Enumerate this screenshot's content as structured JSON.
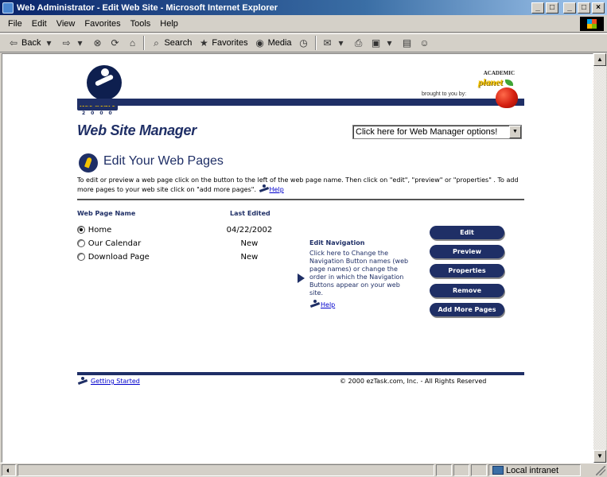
{
  "window": {
    "title": "Web Administrator - Edit Web Site - Microsoft Internet Explorer"
  },
  "menu": [
    "File",
    "Edit",
    "View",
    "Favorites",
    "Tools",
    "Help"
  ],
  "toolbar": {
    "back": "Back",
    "search": "Search",
    "favorites": "Favorites",
    "media": "Media"
  },
  "header": {
    "brought_by": "brought to you by:",
    "partner_top": "ACADEMIC",
    "partner_name": "planet",
    "logo_word": "net Start",
    "logo_year": "2000"
  },
  "site_manager": {
    "title": "Web Site Manager",
    "options_select": "Click here for Web Manager options!"
  },
  "main": {
    "heading": "Edit Your Web Pages",
    "intro": "To edit or preview a web page click on the button to the left of the web page name.  Then click on \"edit\", \"preview\" or \"properties\" .  To add more pages to your web site click on \"add more pages\".",
    "help_label": "Help",
    "col_name": "Web Page Name",
    "col_edited": "Last Edited",
    "pages": [
      {
        "name": "Home",
        "edited": "04/22/2002",
        "selected": true
      },
      {
        "name": "Our Calendar",
        "edited": "New",
        "selected": false
      },
      {
        "name": "Download Page",
        "edited": "New",
        "selected": false
      }
    ],
    "nav_title": "Edit Navigation",
    "nav_text": "Click here to Change the Navigation Button names (web page names) or change the order in which the Navigation Buttons appear on your web site.",
    "nav_help": "Help",
    "buttons": {
      "edit": "Edit",
      "preview": "Preview",
      "properties": "Properties",
      "remove": "Remove",
      "add_more": "Add More Pages"
    }
  },
  "footer": {
    "getting_started": "Getting Started",
    "copyright": "© 2000 ezTask.com, Inc. - All Rights Reserved"
  },
  "status": {
    "zone": "Local intranet"
  }
}
